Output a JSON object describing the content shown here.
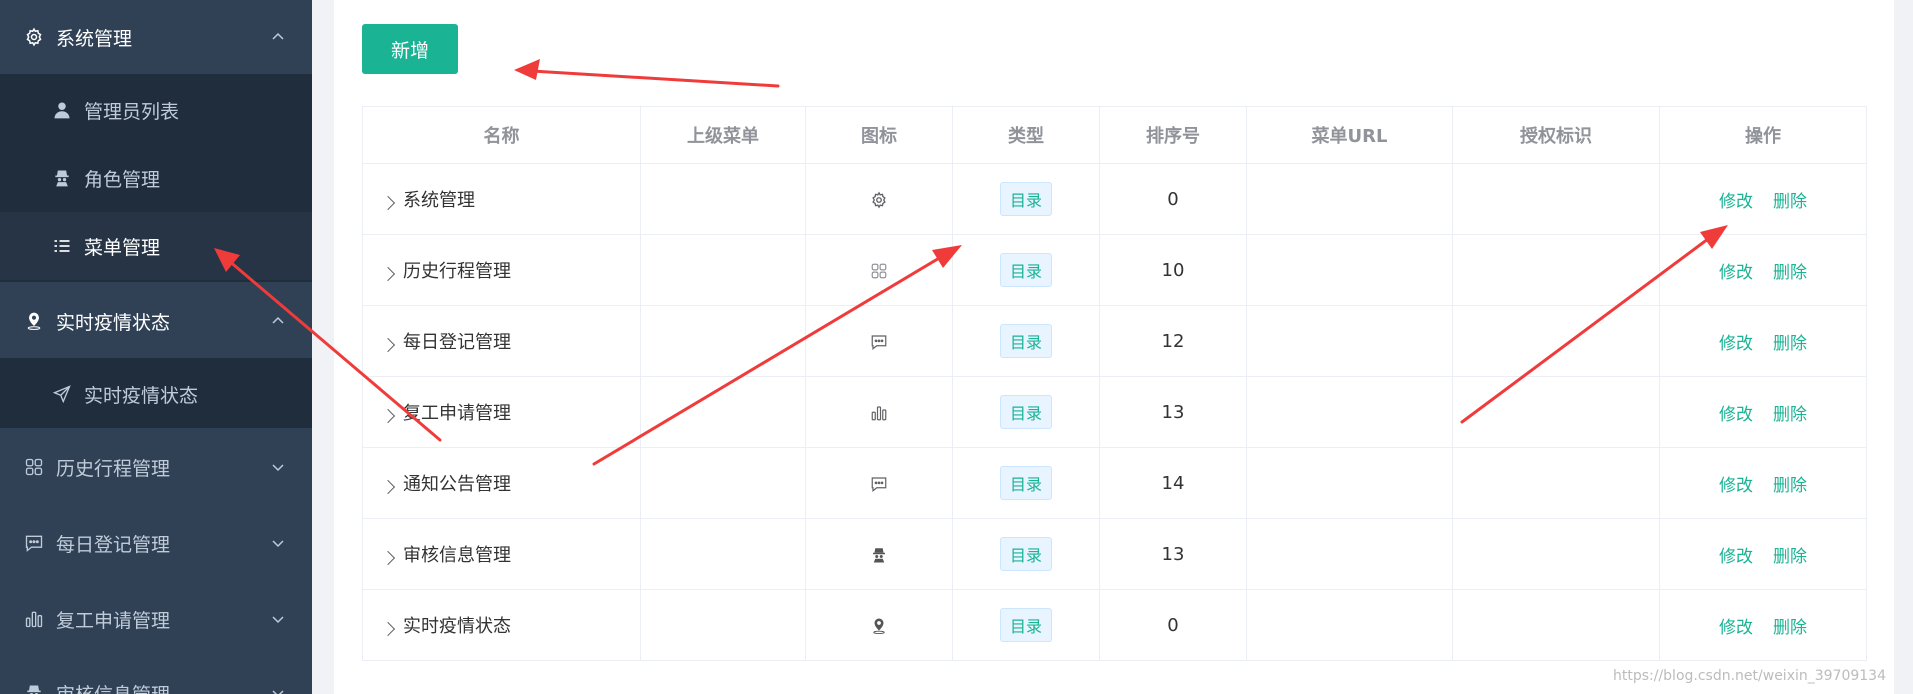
{
  "sidebar": {
    "groups": [
      {
        "label": "系统管理",
        "icon": "gear-icon",
        "open": true
      },
      {
        "label": "实时疫情状态",
        "icon": "location-icon",
        "open": true
      },
      {
        "label": "历史行程管理",
        "icon": "grid-icon",
        "open": false
      },
      {
        "label": "每日登记管理",
        "icon": "message-icon",
        "open": false
      },
      {
        "label": "复工申请管理",
        "icon": "bar-chart-icon",
        "open": false
      },
      {
        "label": "审核信息管理",
        "icon": "detective-icon",
        "open": false
      }
    ],
    "sub_items": [
      {
        "label": "管理员列表",
        "icon": "user-icon"
      },
      {
        "label": "角色管理",
        "icon": "detective-icon"
      },
      {
        "label": "菜单管理",
        "icon": "list-icon",
        "active": true
      },
      {
        "label": "实时疫情状态",
        "icon": "send-icon"
      }
    ]
  },
  "toolbar": {
    "add_label": "新增"
  },
  "table": {
    "headers": [
      "名称",
      "上级菜单",
      "图标",
      "类型",
      "排序号",
      "菜单URL",
      "授权标识",
      "操作"
    ],
    "rows": [
      {
        "name": "系统管理",
        "parent": "",
        "icon": "gear-icon",
        "type": "目录",
        "order": "0",
        "url": "",
        "perm": ""
      },
      {
        "name": "历史行程管理",
        "parent": "",
        "icon": "grid-icon",
        "type": "目录",
        "order": "10",
        "url": "",
        "perm": ""
      },
      {
        "name": "每日登记管理",
        "parent": "",
        "icon": "message-icon",
        "type": "目录",
        "order": "12",
        "url": "",
        "perm": ""
      },
      {
        "name": "复工申请管理",
        "parent": "",
        "icon": "bar-chart-icon",
        "type": "目录",
        "order": "13",
        "url": "",
        "perm": ""
      },
      {
        "name": "通知公告管理",
        "parent": "",
        "icon": "message-icon",
        "type": "目录",
        "order": "14",
        "url": "",
        "perm": ""
      },
      {
        "name": "审核信息管理",
        "parent": "",
        "icon": "detective-icon",
        "type": "目录",
        "order": "13",
        "url": "",
        "perm": ""
      },
      {
        "name": "实时疫情状态",
        "parent": "",
        "icon": "location-icon",
        "type": "目录",
        "order": "0",
        "url": "",
        "perm": ""
      }
    ],
    "edit_label": "修改",
    "delete_label": "删除"
  },
  "watermark": "https://blog.csdn.net/weixin_39709134",
  "colors": {
    "sidebar_bg": "#304156",
    "submenu_bg": "#1f2d3d",
    "accent": "#1ab394",
    "annotation": "#f03b3b"
  }
}
